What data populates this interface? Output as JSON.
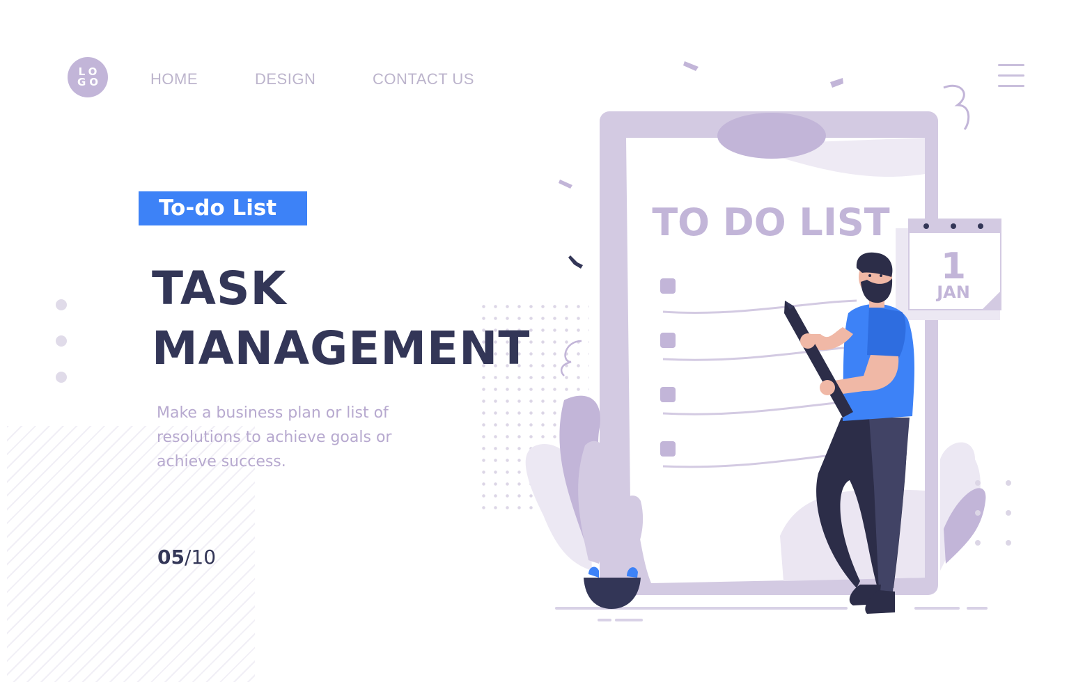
{
  "logo": {
    "line1": "LO",
    "line2": "GO"
  },
  "nav": {
    "home": "HOME",
    "design": "DESIGN",
    "contact": "CONTACT US"
  },
  "menu_icon": "hamburger-menu-icon",
  "hero": {
    "badge": "To-do List",
    "title_line1": "TASK",
    "title_line2": "MANAGEMENT",
    "description": "Make a business plan or list of resolutions to achieve goals or achieve success."
  },
  "pager": {
    "current": "05",
    "separator": "/",
    "total": "10"
  },
  "illustration": {
    "board_title": "TO DO LIST",
    "calendar_day": "1",
    "calendar_month": "JAN"
  },
  "colors": {
    "accent": "#3d82f7",
    "heading": "#333657",
    "lavender": "#c2b5d8",
    "muted_text": "#b7a9cf"
  }
}
